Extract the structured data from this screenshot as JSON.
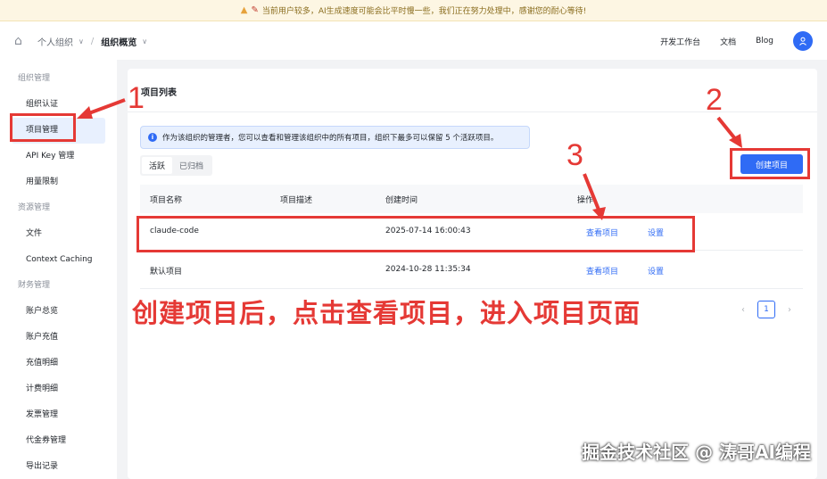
{
  "notice": {
    "text": "当前用户较多，AI生成速度可能会比平时慢一些，我们正在努力处理中，感谢您的耐心等待!"
  },
  "header": {
    "breadcrumb_org": "个人组织",
    "breadcrumb_page": "组织概览",
    "nav": [
      "开发工作台",
      "文档",
      "Blog"
    ]
  },
  "sidebar": {
    "groups": [
      {
        "title": "组织管理",
        "items": [
          "组织认证",
          "项目管理",
          "API Key 管理",
          "用量限制"
        ]
      },
      {
        "title": "资源管理",
        "items": [
          "文件",
          "Context Caching"
        ]
      },
      {
        "title": "财务管理",
        "items": [
          "账户总览",
          "账户充值",
          "充值明细",
          "计费明细",
          "发票管理",
          "代金券管理",
          "导出记录"
        ]
      }
    ],
    "active_item": "项目管理"
  },
  "main": {
    "title": "项目列表",
    "info": "作为该组织的管理者，您可以查看和管理该组织中的所有项目，组织下最多可以保留 5 个活跃项目。",
    "tabs": [
      "活跃",
      "已归档"
    ],
    "create_button": "创建项目",
    "columns": [
      "项目名称",
      "项目描述",
      "创建时间",
      "操作"
    ],
    "rows": [
      {
        "name": "claude-code",
        "description": "",
        "created": "2025-07-14 16:00:43",
        "view": "查看项目",
        "settings": "设置"
      },
      {
        "name": "默认项目",
        "description": "",
        "created": "2024-10-28 11:35:34",
        "view": "查看项目",
        "settings": "设置"
      }
    ],
    "pagination": {
      "prev": "‹",
      "current": "1",
      "next": "›"
    }
  },
  "annotations": {
    "step1": "1",
    "step2": "2",
    "step3": "3",
    "caption": "创建项目后，点击查看项目，进入项目页面",
    "watermark": "掘金技术社区 @ 涛哥AI编程"
  },
  "colors": {
    "accent": "#2f6bf5",
    "annotation_red": "#e53935",
    "notice_bg": "#fdf6e3"
  }
}
